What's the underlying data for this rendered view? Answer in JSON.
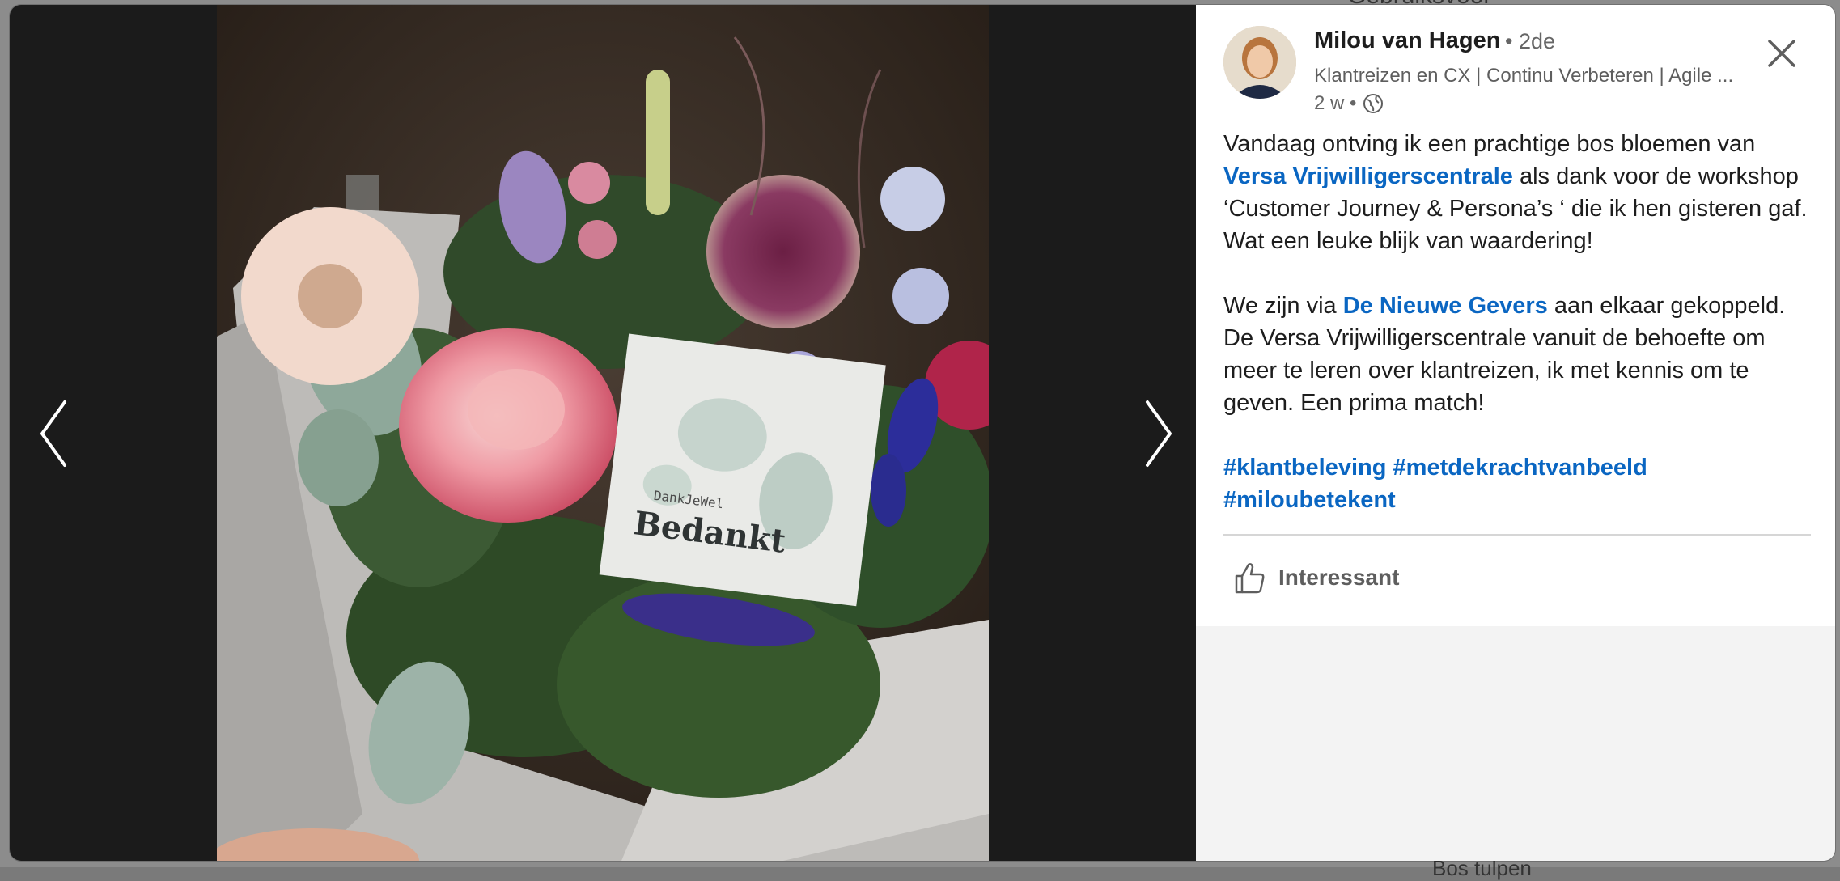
{
  "background": {
    "peek_text": "Gebruiksvoor",
    "peek_text_bottom": "Bos tulpen"
  },
  "viewer": {
    "prev_label": "Vorige",
    "next_label": "Volgende",
    "card_small_text": "DankJeWel",
    "card_big_text": "Bedankt"
  },
  "post": {
    "author": "Milou van Hagen",
    "degree": "• 2de",
    "headline": "Klantreizen en CX | Continu Verbeteren | Agile ...",
    "time": "2 w •",
    "paragraph1": {
      "before": "Vandaag ontving ik een prachtige bos bloemen van ",
      "mention": "Versa Vrijwilligerscentrale",
      "after": " als dank voor de workshop ‘Customer Journey & Persona’s ‘ die ik hen gisteren gaf. Wat een leuke blijk van waardering!"
    },
    "paragraph2": {
      "before": "We zijn via ",
      "mention": "De Nieuwe Gevers",
      "after": " aan elkaar gekoppeld. De Versa Vrijwilligerscentrale vanuit de behoefte om meer te leren over klantreizen, ik met kennis om te geven. Een prima match!"
    },
    "hashtags": [
      "#klantbeleving",
      "#metdekrachtvanbeeld",
      "#miloubetekent"
    ],
    "reaction_label": "Interessant"
  },
  "colors": {
    "link": "#0a66c2",
    "viewer_bg": "#1b1b1b",
    "panel_bg": "#ffffff"
  }
}
